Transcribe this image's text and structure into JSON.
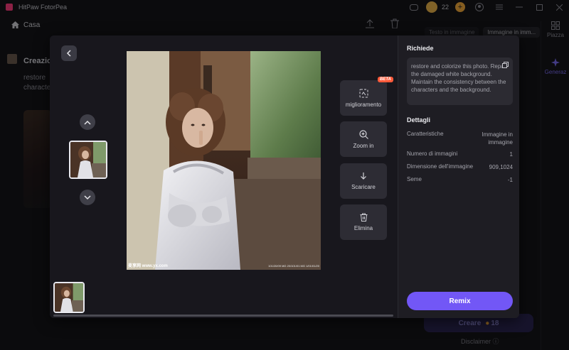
{
  "app": {
    "title": "HitPaw FotorPea",
    "credits": "22"
  },
  "header": {
    "home_label": "Casa"
  },
  "background": {
    "card_title": "Creazio",
    "card_text_line1": "restore",
    "card_text_line2": "characte",
    "tabs": [
      "Testo in immagine",
      "Immagine in imm..."
    ],
    "side_items": [
      "Piazza",
      "Generaz"
    ],
    "create_label": "Creare",
    "create_cost": "18",
    "disclaimer": "Disclaimer"
  },
  "modal": {
    "watermark_left": "麦享网 www.yx.com",
    "watermark_right": "101/20/09 MG 20/101/01 MG 1/01/01/20",
    "actions": {
      "enhance_label": "miglioramento",
      "enhance_badge": "BETA",
      "zoom_label": "Zoom in",
      "download_label": "Scaricare",
      "delete_label": "Elimina"
    },
    "prompt": {
      "title": "Richiede",
      "text": "restore and colorize this photo. Repair the damaged white background. Maintain the consistency between the characters and the background."
    },
    "details": {
      "title": "Dettagli",
      "rows": [
        {
          "label": "Caratteristiche",
          "value": "Immagine in immagine"
        },
        {
          "label": "Numero di immagini",
          "value": "1"
        },
        {
          "label": "Dimensione dell'immagine",
          "value": "909,1024"
        },
        {
          "label": "Seme",
          "value": "-1"
        }
      ]
    },
    "remix_label": "Remix"
  }
}
